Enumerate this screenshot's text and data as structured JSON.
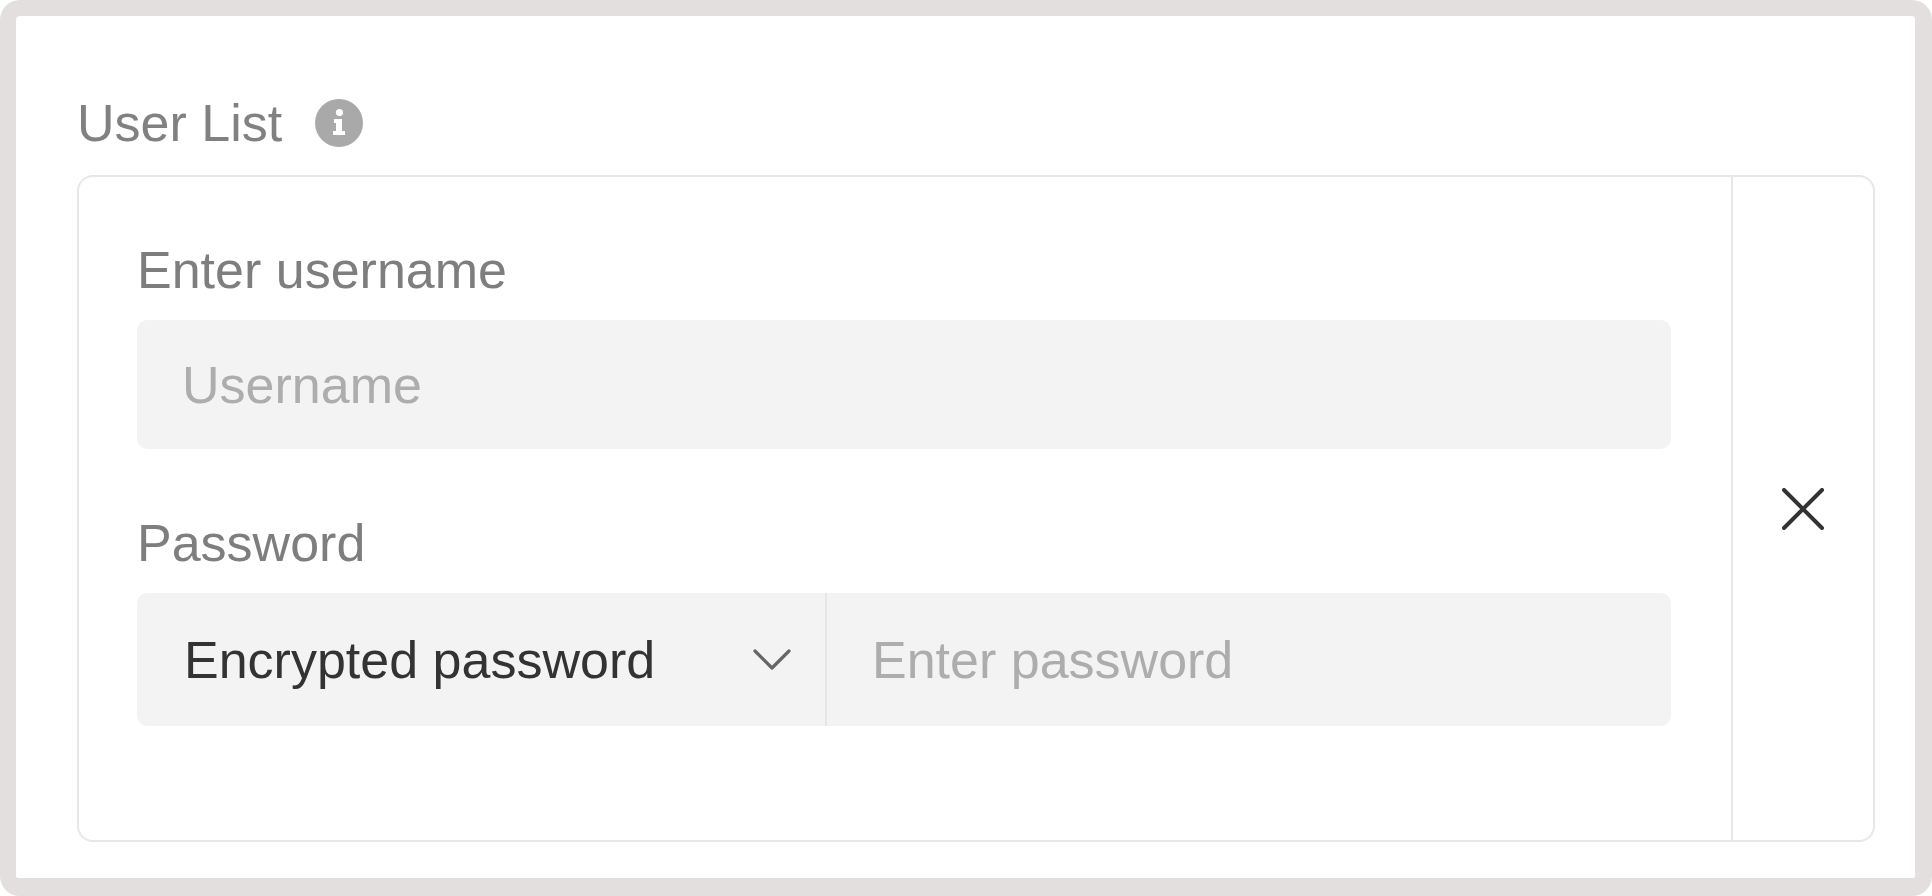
{
  "section": {
    "title": "User List"
  },
  "user_entries": [
    {
      "username": {
        "label": "Enter username",
        "placeholder": "Username"
      },
      "password": {
        "label": "Password",
        "type_select": {
          "value": "Encrypted password"
        },
        "placeholder": "Enter password"
      }
    }
  ]
}
